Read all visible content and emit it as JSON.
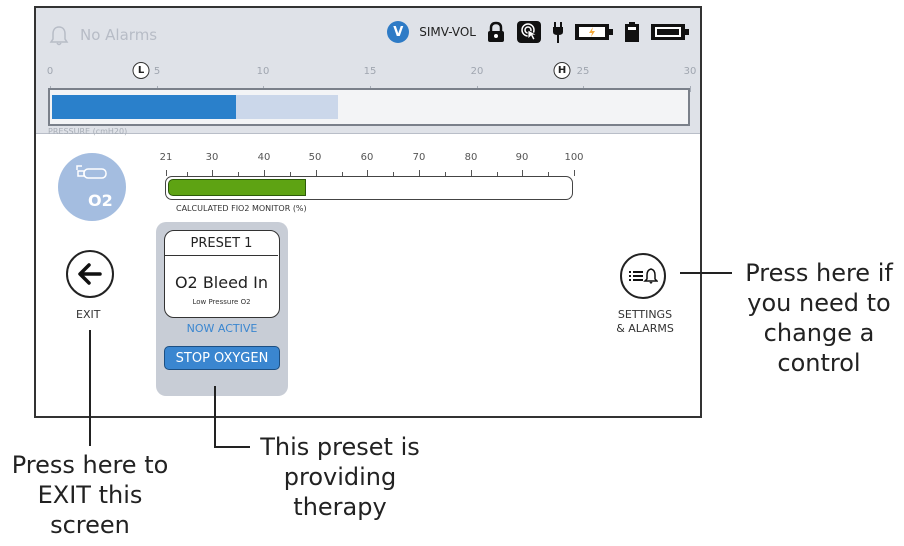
{
  "status_bar": {
    "alarm_text": "No Alarms",
    "mode_badge": "V",
    "mode_text": "SIMV-VOL"
  },
  "pressure": {
    "scale_labels": [
      "0",
      "5",
      "10",
      "15",
      "20",
      "25",
      "30"
    ],
    "low_marker": "L",
    "high_marker": "H",
    "label": "PRESSURE (cmH20)"
  },
  "fio2": {
    "scale_labels": [
      "21",
      "30",
      "40",
      "50",
      "60",
      "70",
      "80",
      "90",
      "100"
    ],
    "value_percent": 48,
    "label": "CALCULATED FIO2 MONITOR (%)"
  },
  "o2_icon": {
    "text": "O2"
  },
  "exit": {
    "label": "EXIT"
  },
  "preset": {
    "title": "PRESET 1",
    "name": "O2 Bleed In",
    "subtitle": "Low Pressure O2",
    "status": "NOW ACTIVE",
    "stop_button": "STOP OXYGEN"
  },
  "settings": {
    "label_line1": "SETTINGS",
    "label_line2": "& ALARMS"
  },
  "callouts": {
    "settings": [
      "Press here if",
      "you need to",
      "change a",
      "control"
    ],
    "preset": [
      "This preset is",
      "providing",
      "therapy"
    ],
    "exit": [
      "Press here to",
      "EXIT this",
      "screen"
    ]
  },
  "colors": {
    "accent_blue": "#2e7bc6",
    "fio2_green": "#5ea313",
    "panel_gray": "#c8cdd6",
    "topbar_gray": "#dfe2e8"
  }
}
